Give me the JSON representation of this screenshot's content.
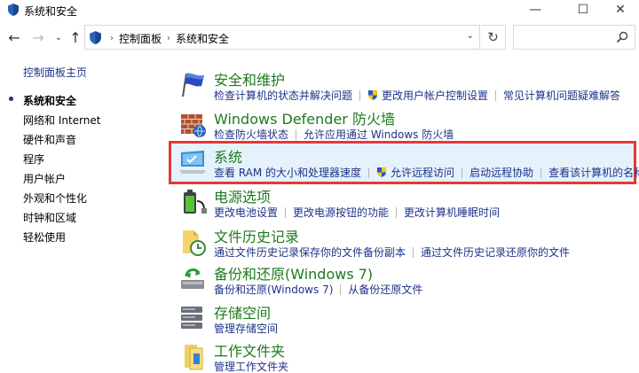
{
  "window": {
    "title": "系统和安全",
    "minimize": "—",
    "maximize": "☐",
    "close": "✕"
  },
  "nav": {
    "back": "←",
    "forward": "→",
    "recent": "⌄",
    "up": "↑",
    "breadcrumb": [
      "控制面板",
      "系统和安全"
    ],
    "separator": "›",
    "dropdown": "⌄",
    "refresh": "↻",
    "search_placeholder": ""
  },
  "sidebar": {
    "items": [
      {
        "label": "控制面板主页"
      },
      {
        "label": "系统和安全"
      },
      {
        "label": "网络和 Internet"
      },
      {
        "label": "硬件和声音"
      },
      {
        "label": "程序"
      },
      {
        "label": "用户帐户"
      },
      {
        "label": "外观和个性化"
      },
      {
        "label": "时钟和区域"
      },
      {
        "label": "轻松使用"
      }
    ]
  },
  "categories": [
    {
      "title": "安全和维护",
      "icon": "flag-icon",
      "links": [
        "检查计算机的状态并解决问题",
        "更改用户帐户控制设置",
        "常见计算机问题疑难解答"
      ],
      "shield_links": [
        1
      ]
    },
    {
      "title": "Windows Defender 防火墙",
      "icon": "firewall-icon",
      "links": [
        "检查防火墙状态",
        "允许应用通过 Windows 防火墙"
      ],
      "shield_links": []
    },
    {
      "title": "系统",
      "icon": "computer-icon",
      "links": [
        "查看 RAM 的大小和处理器速度",
        "允许远程访问",
        "启动远程协助",
        "查看该计算机的名称"
      ],
      "shield_links": [
        1
      ]
    },
    {
      "title": "电源选项",
      "icon": "power-icon",
      "links": [
        "更改电池设置",
        "更改电源按钮的功能",
        "更改计算机睡眠时间"
      ],
      "shield_links": []
    },
    {
      "title": "文件历史记录",
      "icon": "file-history-icon",
      "links": [
        "通过文件历史记录保存你的文件备份副本",
        "通过文件历史记录还原你的文件"
      ],
      "shield_links": []
    },
    {
      "title": "备份和还原(Windows 7)",
      "icon": "backup-icon",
      "links": [
        "备份和还原(Windows 7)",
        "从备份还原文件"
      ],
      "shield_links": []
    },
    {
      "title": "存储空间",
      "icon": "storage-icon",
      "links": [
        "管理存储空间"
      ],
      "shield_links": []
    },
    {
      "title": "工作文件夹",
      "icon": "work-folders-icon",
      "links": [
        "管理工作文件夹"
      ],
      "shield_links": []
    }
  ],
  "colors": {
    "link": "#1e3287",
    "title_green": "#1e7a1e",
    "highlight_bg": "#e5f1fb",
    "highlight_border": "#e53838"
  }
}
